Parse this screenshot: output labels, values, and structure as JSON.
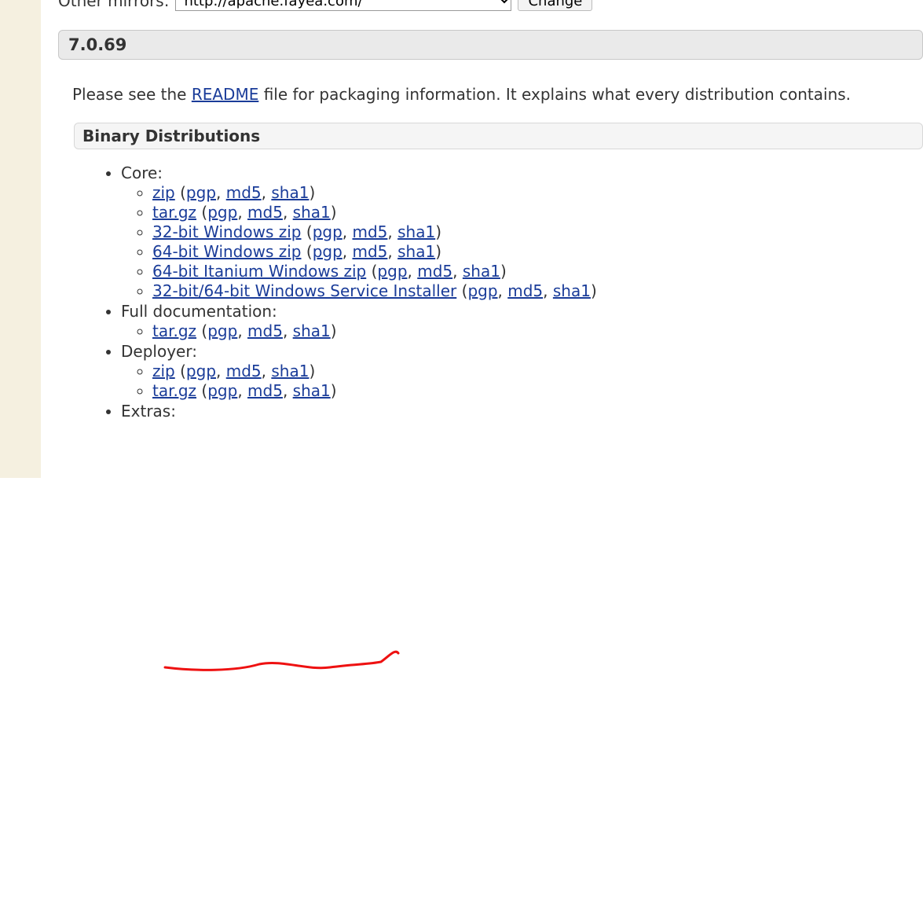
{
  "mirror_bar": {
    "label": "Other mirrors:",
    "selected": "http://apache.fayea.com/",
    "change_btn": "Change"
  },
  "version_heading": "7.0.69",
  "intro": {
    "prefix": "Please see the ",
    "readme_link": "README",
    "suffix": " file for packaging information. It explains what every distribution contains."
  },
  "binary_heading": "Binary Distributions",
  "sections": {
    "core_label": "Core:",
    "core": [
      {
        "name": "zip",
        "sigs": [
          "pgp",
          "md5",
          "sha1"
        ]
      },
      {
        "name": "tar.gz",
        "sigs": [
          "pgp",
          "md5",
          "sha1"
        ]
      },
      {
        "name": "32-bit Windows zip",
        "sigs": [
          "pgp",
          "md5",
          "sha1"
        ]
      },
      {
        "name": "64-bit Windows zip",
        "sigs": [
          "pgp",
          "md5",
          "sha1"
        ]
      },
      {
        "name": "64-bit Itanium Windows zip",
        "sigs": [
          "pgp",
          "md5",
          "sha1"
        ]
      },
      {
        "name": "32-bit/64-bit Windows Service Installer",
        "sigs": [
          "pgp",
          "md5",
          "sha1"
        ]
      }
    ],
    "fulldoc_label": "Full documentation:",
    "fulldoc": [
      {
        "name": "tar.gz",
        "sigs": [
          "pgp",
          "md5",
          "sha1"
        ]
      }
    ],
    "deployer_label": "Deployer:",
    "deployer": [
      {
        "name": "zip",
        "sigs": [
          "pgp",
          "md5",
          "sha1"
        ]
      },
      {
        "name": "tar.gz",
        "sigs": [
          "pgp",
          "md5",
          "sha1"
        ]
      }
    ],
    "extras_label": "Extras:"
  }
}
